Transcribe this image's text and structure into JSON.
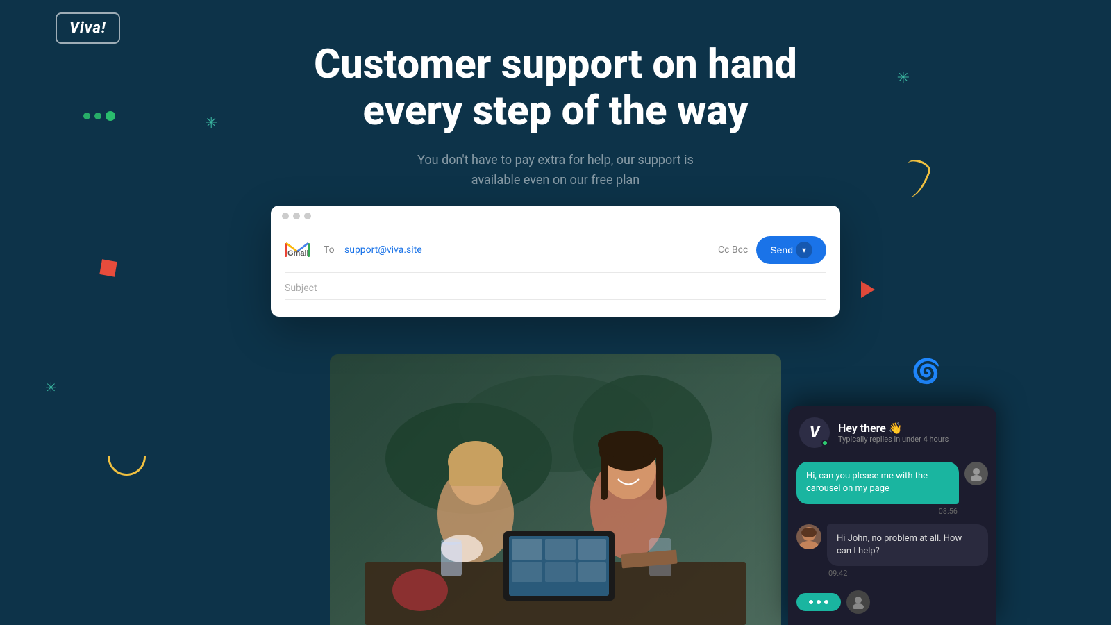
{
  "logo": {
    "text": "Viva!"
  },
  "hero": {
    "title": "Customer support on hand every step of the way",
    "subtitle": "You don't have to pay extra for help, our support is available even on our free plan"
  },
  "gmail": {
    "to_label": "To",
    "to_value": "support@viva.site",
    "cc_bcc": "Cc Bcc",
    "send_btn": "Send",
    "subject_placeholder": "Subject"
  },
  "chat": {
    "agent_name": "Hey there 👋",
    "agent_status": "Typically replies in under 4 hours",
    "user_message": "Hi, can you please me with the carousel on my page",
    "user_time": "08:56",
    "support_message": "Hi John, no problem at all. How can I help?",
    "support_time": "09:42",
    "typing_dots": [
      "•",
      "•",
      "•"
    ]
  },
  "colors": {
    "bg": "#0d3349",
    "teal": "#1ab5a0",
    "dark_chat": "#1a1a2e",
    "gmail_blue": "#1a73e8",
    "green_deco": "#2ecc71",
    "yellow_deco": "#f0c040",
    "red_deco": "#e74c3c"
  }
}
